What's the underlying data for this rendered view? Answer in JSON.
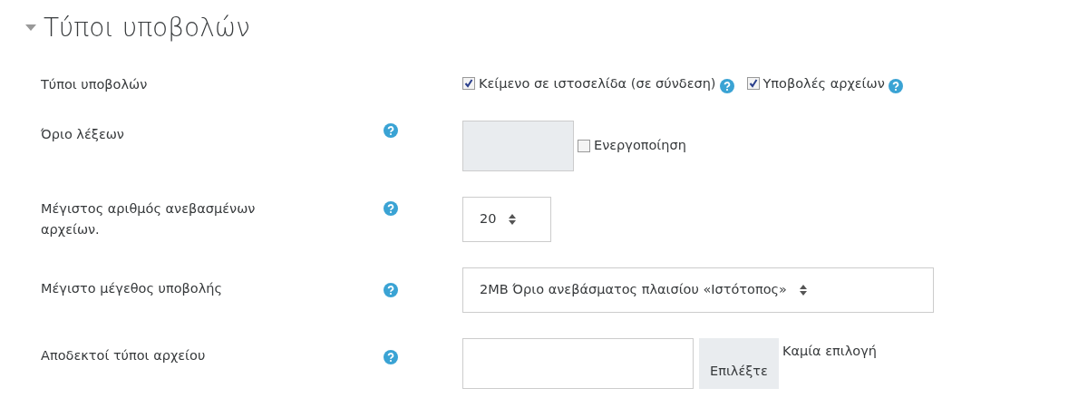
{
  "section": {
    "title": "Τύποι υποβολών",
    "expanded": true
  },
  "rows": [
    {
      "kind": "checkboxes",
      "label": "Τύποι υποβολών",
      "help": false,
      "options": [
        {
          "label": "Κείμενο σε ιστοσελίδα (σε σύνδεση)",
          "checked": true
        },
        {
          "label": "Υποβολές αρχείων",
          "checked": true
        }
      ]
    },
    {
      "kind": "limit",
      "label": "Όριο λέξεων",
      "help": true,
      "disabled": true,
      "option": {
        "label": "Ενεργοποίηση",
        "checked": false
      }
    },
    {
      "kind": "select",
      "label": "Μέγιστος αριθμός ανεβασμένων αρχείων.",
      "help": true,
      "value": "20",
      "wide": false
    },
    {
      "kind": "select",
      "label": "Μέγιστο μέγεθος υποβολής",
      "help": true,
      "value": "2MB Όριο ανεβάσματος πλαισίου «Ιστότοπος»",
      "wide": true
    },
    {
      "kind": "filetypes",
      "label": "Αποδεκτοί τύποι αρχείου",
      "help": true,
      "button": "Επιλέξτε",
      "note": "Καμία επιλογή"
    }
  ]
}
